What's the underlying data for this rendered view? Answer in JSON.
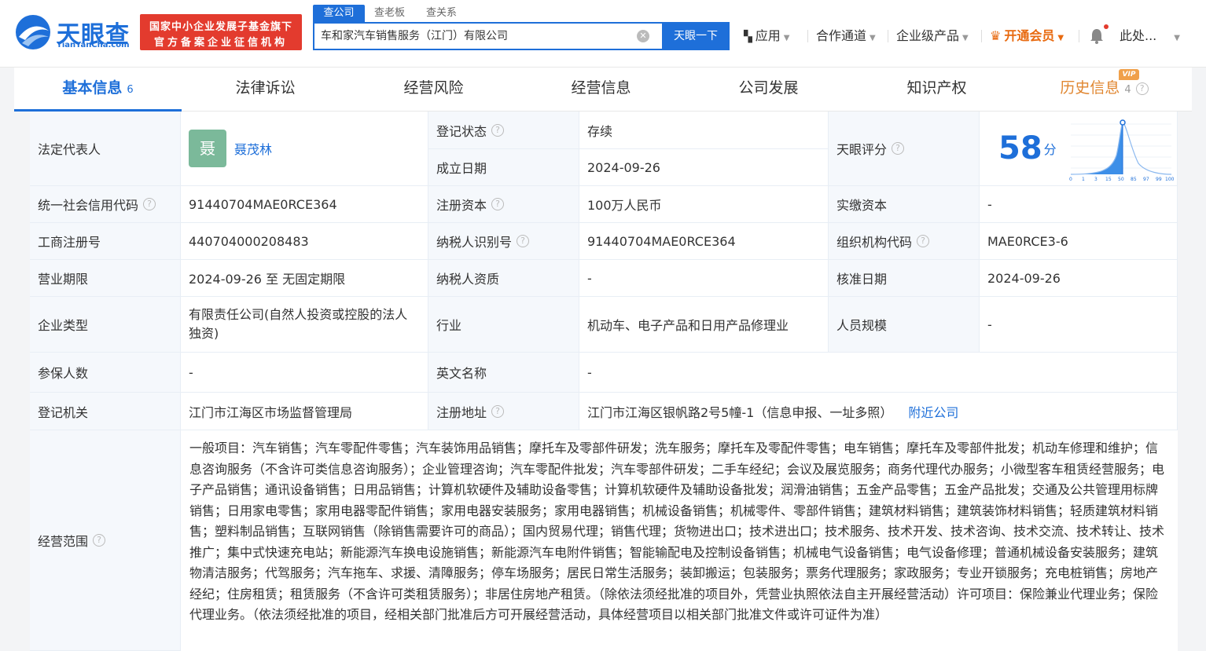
{
  "header": {
    "logo_cn": "天眼查",
    "logo_en": "TianYanCha.com",
    "badge_line1": "国家中小企业发展子基金旗下",
    "badge_line2": "官方备案企业征信机构",
    "search_tabs": [
      "查公司",
      "查老板",
      "查关系"
    ],
    "search_value": "车和家汽车销售服务（江门）有限公司",
    "search_button": "天眼一下",
    "nav": {
      "apps": "应用",
      "cooperation": "合作通道",
      "enterprise": "企业级产品",
      "vip": "开通会员",
      "user": "此处..."
    }
  },
  "tabs": [
    {
      "label": "基本信息",
      "count": "6"
    },
    {
      "label": "法律诉讼"
    },
    {
      "label": "经营风险"
    },
    {
      "label": "经营信息"
    },
    {
      "label": "公司发展"
    },
    {
      "label": "知识产权"
    },
    {
      "label": "历史信息",
      "count": "4",
      "tag": "VIP"
    }
  ],
  "info": {
    "legal_rep_label": "法定代表人",
    "legal_rep_avatar": "聂",
    "legal_rep_name": "聂茂林",
    "reg_status_label": "登记状态",
    "reg_status": "存续",
    "found_date_label": "成立日期",
    "found_date": "2024-09-26",
    "score_label": "天眼评分",
    "score": "58",
    "score_unit": "分",
    "score_ticks": [
      "0",
      "1",
      "3",
      "15",
      "50",
      "85",
      "97",
      "99",
      "100"
    ],
    "credit_code_label": "统一社会信用代码",
    "credit_code": "91440704MAE0RCE364",
    "reg_capital_label": "注册资本",
    "reg_capital": "100万人民币",
    "paid_capital_label": "实缴资本",
    "paid_capital": "-",
    "biz_reg_no_label": "工商注册号",
    "biz_reg_no": "440704000208483",
    "taxpayer_id_label": "纳税人识别号",
    "taxpayer_id": "91440704MAE0RCE364",
    "org_code_label": "组织机构代码",
    "org_code": "MAE0RCE3-6",
    "term_label": "营业期限",
    "term": "2024-09-26 至 无固定期限",
    "taxpayer_qual_label": "纳税人资质",
    "taxpayer_qual": "-",
    "approve_date_label": "核准日期",
    "approve_date": "2024-09-26",
    "type_label": "企业类型",
    "type": "有限责任公司(自然人投资或控股的法人独资)",
    "industry_label": "行业",
    "industry": "机动车、电子产品和日用产品修理业",
    "staff_label": "人员规模",
    "staff": "-",
    "insured_label": "参保人数",
    "insured": "-",
    "en_name_label": "英文名称",
    "en_name": "-",
    "reg_authority_label": "登记机关",
    "reg_authority": "江门市江海区市场监督管理局",
    "address_label": "注册地址",
    "address": "江门市江海区银帆路2号5幢-1（信息申报、一址多照）",
    "nearby_link": "附近公司",
    "scope_label": "经营范围",
    "scope": "一般项目：汽车销售；汽车零配件零售；汽车装饰用品销售；摩托车及零部件研发；洗车服务；摩托车及零配件零售；电车销售；摩托车及零部件批发；机动车修理和维护；信息咨询服务（不含许可类信息咨询服务）；企业管理咨询；汽车零配件批发；汽车零部件研发；二手车经纪；会议及展览服务；商务代理代办服务；小微型客车租赁经营服务；电子产品销售；通讯设备销售；日用品销售；计算机软硬件及辅助设备零售；计算机软硬件及辅助设备批发；润滑油销售；五金产品零售；五金产品批发；交通及公共管理用标牌销售；日用家电零售；家用电器零配件销售；家用电器安装服务；家用电器销售；机械设备销售；机械零件、零部件销售；建筑材料销售；建筑装饰材料销售；轻质建筑材料销售；塑料制品销售；互联网销售（除销售需要许可的商品）；国内贸易代理；销售代理；货物进出口；技术进出口；技术服务、技术开发、技术咨询、技术交流、技术转让、技术推广；集中式快速充电站；新能源汽车换电设施销售；新能源汽车电附件销售；智能输配电及控制设备销售；机械电气设备销售；电气设备修理；普通机械设备安装服务；建筑物清洁服务；代驾服务；汽车拖车、求援、清障服务；停车场服务；居民日常生活服务；装卸搬运；包装服务；票务代理服务；家政服务；专业开锁服务；充电桩销售；房地产经纪；住房租赁；租赁服务（不含许可类租赁服务）；非居住房地产租赁。（除依法须经批准的项目外，凭营业执照依法自主开展经营活动）许可项目：保险兼业代理业务；保险代理业务。（依法须经批准的项目，经相关部门批准后方可开展经营活动，具体经营项目以相关部门批准文件或许可证件为准）"
  }
}
